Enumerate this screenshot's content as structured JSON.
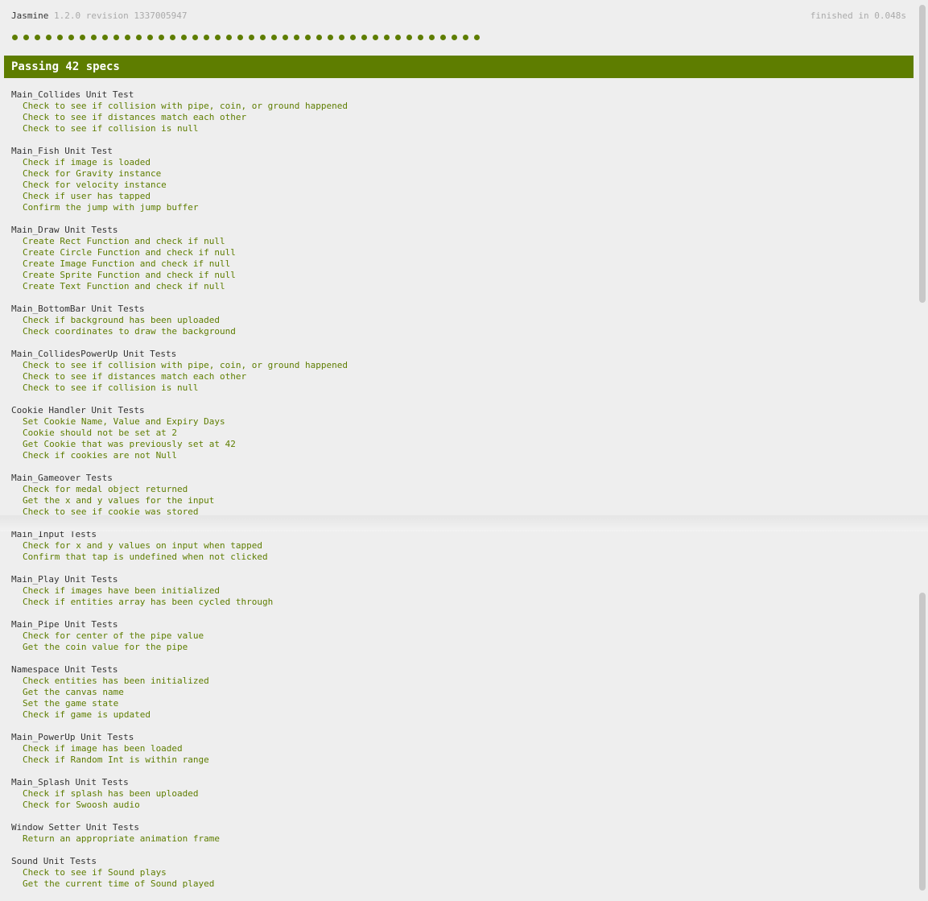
{
  "header": {
    "title": "Jasmine",
    "version": "1.2.0 revision 1337005947",
    "duration": "finished in 0.048s"
  },
  "summary": {
    "text": "Passing 42 specs",
    "passed_count": 42
  },
  "colors": {
    "passed": "#5e7d00",
    "background": "#eeeeee",
    "text": "#333333",
    "muted": "#aaaaaa"
  },
  "suites": [
    {
      "title": "Main_Collides Unit Test",
      "specs": [
        "Check to see if collision with pipe, coin, or ground happened",
        "Check to see if distances match each other",
        "Check to see if collision is null"
      ]
    },
    {
      "title": "Main_Fish Unit Test",
      "specs": [
        "Check if image is loaded",
        "Check for Gravity instance",
        "Check for velocity instance",
        "Check if user has tapped",
        "Confirm the jump with jump buffer"
      ]
    },
    {
      "title": "Main_Draw Unit Tests",
      "specs": [
        "Create Rect Function and check if null",
        "Create Circle Function and check if null",
        "Create Image Function and check if null",
        "Create Sprite Function and check if null",
        "Create Text Function and check if null"
      ]
    },
    {
      "title": "Main_BottomBar Unit Tests",
      "specs": [
        "Check if background has been uploaded",
        "Check coordinates to draw the background"
      ]
    },
    {
      "title": "Main_CollidesPowerUp Unit Tests",
      "specs": [
        "Check to see if collision with pipe, coin, or ground happened",
        "Check to see if distances match each other",
        "Check to see if collision is null"
      ]
    },
    {
      "title": "Cookie Handler Unit Tests",
      "specs": [
        "Set Cookie Name, Value and Expiry Days",
        "Cookie should not be set at 2",
        "Get Cookie that was previously set at 42",
        "Check if cookies are not Null"
      ]
    },
    {
      "title": "Main_Gameover Tests",
      "specs": [
        "Check for medal object returned",
        "Get the x and y values for the input",
        "Check to see if cookie was stored"
      ]
    },
    {
      "title": "Main_Input Tests",
      "specs": [
        "Check for x and y values on input when tapped",
        "Confirm that tap is undefined when not clicked"
      ]
    },
    {
      "title": "Main_Play Unit Tests",
      "specs": [
        "Check if images have been initialized",
        "Check if entities array has been cycled through"
      ]
    },
    {
      "title": "Main_Pipe Unit Tests",
      "specs": [
        "Check for center of the pipe value",
        "Get the coin value for the pipe"
      ]
    },
    {
      "title": "Namespace Unit Tests",
      "specs": [
        "Check entities has been initialized",
        "Get the canvas name",
        "Set the game state",
        "Check if game is updated"
      ]
    },
    {
      "title": "Main_PowerUp Unit Tests",
      "specs": [
        "Check if image has been loaded",
        "Check if Random Int is within range"
      ]
    },
    {
      "title": "Main_Splash Unit Tests",
      "specs": [
        "Check if splash has been uploaded",
        "Check for Swoosh audio"
      ]
    },
    {
      "title": "Window Setter Unit Tests",
      "specs": [
        "Return an appropriate animation frame"
      ]
    },
    {
      "title": "Sound Unit Tests",
      "specs": [
        "Check to see if Sound plays",
        "Get the current time of Sound played"
      ]
    }
  ]
}
